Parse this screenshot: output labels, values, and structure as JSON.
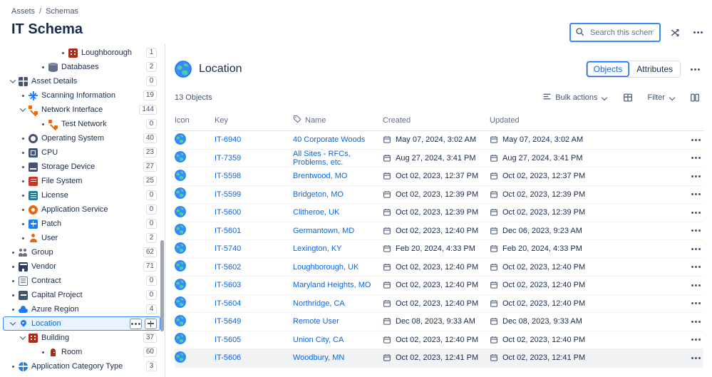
{
  "breadcrumb": {
    "items": [
      "Assets",
      "Schemas"
    ],
    "separator": "/"
  },
  "page": {
    "title": "IT Schema"
  },
  "search": {
    "placeholder": "Search this schema..."
  },
  "colors": {
    "accent": "#0C66E4",
    "link": "#0C66E4",
    "selected_background": "#E9F2FF",
    "selected_border": "#388BFF"
  },
  "sidebar": {
    "items": [
      {
        "label": "Loughborough",
        "count": "1",
        "depth": 3,
        "icon": "building",
        "marker": "bullet"
      },
      {
        "label": "Databases",
        "count": "2",
        "depth": 2,
        "icon": "database",
        "marker": "bullet"
      },
      {
        "label": "Asset Details",
        "count": "0",
        "depth": 0,
        "icon": "asset-details",
        "marker": "chevron"
      },
      {
        "label": "Scanning Information",
        "count": "19",
        "depth": 1,
        "icon": "scanning-information",
        "marker": "bullet"
      },
      {
        "label": "Network Interface",
        "count": "144",
        "depth": 1,
        "icon": "network-interface",
        "marker": "chevron"
      },
      {
        "label": "Test Network",
        "count": "0",
        "depth": 2,
        "icon": "network-interface",
        "marker": "bullet"
      },
      {
        "label": "Operating System",
        "count": "40",
        "depth": 1,
        "icon": "operating-system",
        "marker": "bullet"
      },
      {
        "label": "CPU",
        "count": "23",
        "depth": 1,
        "icon": "cpu",
        "marker": "bullet"
      },
      {
        "label": "Storage Device",
        "count": "27",
        "depth": 1,
        "icon": "storage-device",
        "marker": "bullet"
      },
      {
        "label": "File System",
        "count": "25",
        "depth": 1,
        "icon": "file-system",
        "marker": "bullet"
      },
      {
        "label": "License",
        "count": "0",
        "depth": 1,
        "icon": "license",
        "marker": "bullet"
      },
      {
        "label": "Application Service",
        "count": "0",
        "depth": 1,
        "icon": "application-service",
        "marker": "bullet"
      },
      {
        "label": "Patch",
        "count": "0",
        "depth": 1,
        "icon": "patch",
        "marker": "bullet"
      },
      {
        "label": "User",
        "count": "2",
        "depth": 1,
        "icon": "user",
        "marker": "bullet"
      },
      {
        "label": "Group",
        "count": "62",
        "depth": 0,
        "icon": "group",
        "marker": "bullet"
      },
      {
        "label": "Vendor",
        "count": "71",
        "depth": 0,
        "icon": "vendor",
        "marker": "bullet"
      },
      {
        "label": "Contract",
        "count": "0",
        "depth": 0,
        "icon": "contract",
        "marker": "bullet"
      },
      {
        "label": "Capital Project",
        "count": "0",
        "depth": 0,
        "icon": "capital-project",
        "marker": "bullet"
      },
      {
        "label": "Azure Region",
        "count": "4",
        "depth": 0,
        "icon": "azure-region",
        "marker": "bullet"
      },
      {
        "label": "Location",
        "count": null,
        "depth": 0,
        "icon": "location",
        "marker": "chevron",
        "selected": true
      },
      {
        "label": "Building",
        "count": "37",
        "depth": 1,
        "icon": "building",
        "marker": "chevron"
      },
      {
        "label": "Room",
        "count": "60",
        "depth": 2,
        "icon": "room",
        "marker": "bullet"
      },
      {
        "label": "Application Category Type",
        "count": "3",
        "depth": 0,
        "icon": "application-category-type",
        "marker": "bullet"
      }
    ]
  },
  "main": {
    "object_type": {
      "name": "Location"
    },
    "tabs": [
      {
        "label": "Objects",
        "active": true
      },
      {
        "label": "Attributes",
        "active": false
      }
    ],
    "summary": "13 Objects",
    "toolbar": {
      "bulk_actions_label": "Bulk actions",
      "filter_label": "Filter"
    },
    "table": {
      "headers": [
        "Icon",
        "Key",
        "Name",
        "Created",
        "Updated"
      ],
      "rows": [
        {
          "key": "IT-6940",
          "name": "40 Corporate Woods",
          "created": "May 07, 2024, 3:02 AM",
          "updated": "May 07, 2024, 3:02 AM"
        },
        {
          "key": "IT-7359",
          "name": "All Sites - RFCs, Problems, etc.",
          "created": "Aug 27, 2024, 3:41 PM",
          "updated": "Aug 27, 2024, 3:41 PM"
        },
        {
          "key": "IT-5598",
          "name": "Brentwood, MO",
          "created": "Oct 02, 2023, 12:37 PM",
          "updated": "Oct 02, 2023, 12:37 PM"
        },
        {
          "key": "IT-5599",
          "name": "Bridgeton, MO",
          "created": "Oct 02, 2023, 12:39 PM",
          "updated": "Oct 02, 2023, 12:39 PM"
        },
        {
          "key": "IT-5600",
          "name": "Clitheroe, UK",
          "created": "Oct 02, 2023, 12:39 PM",
          "updated": "Oct 02, 2023, 12:39 PM"
        },
        {
          "key": "IT-5601",
          "name": "Germantown, MD",
          "created": "Oct 02, 2023, 12:40 PM",
          "updated": "Dec 06, 2023, 9:23 AM"
        },
        {
          "key": "IT-5740",
          "name": "Lexington, KY",
          "created": "Feb 20, 2024, 4:33 PM",
          "updated": "Feb 20, 2024, 4:33 PM"
        },
        {
          "key": "IT-5602",
          "name": "Loughborough, UK",
          "created": "Oct 02, 2023, 12:40 PM",
          "updated": "Oct 02, 2023, 12:40 PM"
        },
        {
          "key": "IT-5603",
          "name": "Maryland Heights, MO",
          "created": "Oct 02, 2023, 12:40 PM",
          "updated": "Oct 02, 2023, 12:40 PM"
        },
        {
          "key": "IT-5604",
          "name": "Northridge, CA",
          "created": "Oct 02, 2023, 12:40 PM",
          "updated": "Oct 02, 2023, 12:40 PM"
        },
        {
          "key": "IT-5649",
          "name": "Remote User",
          "created": "Dec 08, 2023, 9:33 AM",
          "updated": "Dec 08, 2023, 9:33 AM"
        },
        {
          "key": "IT-5605",
          "name": "Union City, CA",
          "created": "Oct 02, 2023, 12:40 PM",
          "updated": "Oct 02, 2023, 12:40 PM"
        },
        {
          "key": "IT-5606",
          "name": "Woodbury, MN",
          "created": "Oct 02, 2023, 12:41 PM",
          "updated": "Oct 02, 2023, 12:41 PM",
          "highlighted": true
        }
      ]
    }
  }
}
